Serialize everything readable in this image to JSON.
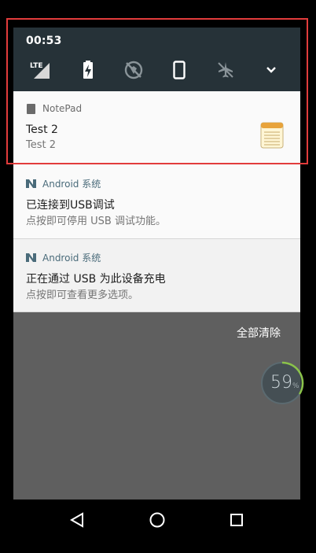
{
  "status": {
    "time": "00:53",
    "toggles": [
      {
        "icon": "lte-signal-icon",
        "label": "LTE"
      },
      {
        "icon": "battery-charging-icon"
      },
      {
        "icon": "location-off-icon"
      },
      {
        "icon": "phone-rotate-icon"
      },
      {
        "icon": "airplane-mode-icon"
      },
      {
        "icon": "expand-chevron-icon"
      }
    ]
  },
  "notifications": [
    {
      "app": "NotePad",
      "title": "Test 2",
      "text": "Test 2",
      "icon": "notepad-icon"
    },
    {
      "app": "Android 系统",
      "title": "已连接到USB调试",
      "text": "点按即可停用 USB 调试功能。"
    },
    {
      "app": "Android 系统",
      "title": "正在通过 USB 为此设备充电",
      "text": "点按即可查看更多选项。"
    }
  ],
  "clear_all_label": "全部清除",
  "battery_widget": {
    "value": "59",
    "unit": "%",
    "percent": 59
  },
  "nav": [
    {
      "icon": "back-icon"
    },
    {
      "icon": "home-icon"
    },
    {
      "icon": "recents-icon"
    }
  ],
  "colors": {
    "quick_settings_bg": "#263238",
    "highlight": "#e23c3c"
  }
}
